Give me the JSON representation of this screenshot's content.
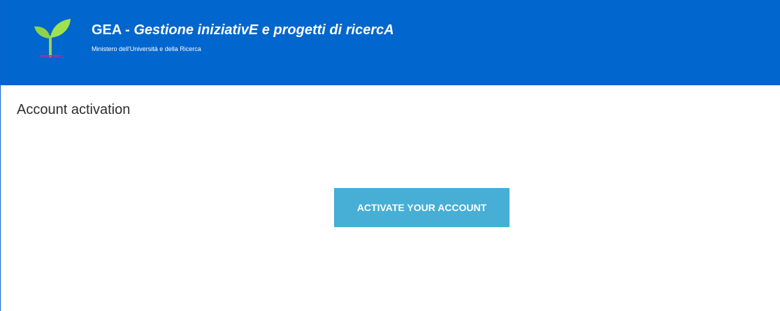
{
  "header": {
    "title_prefix": "GEA - ",
    "title_italic": "Gestione iniziativE e progetti di ricercA",
    "subtitle": "Ministero dell'Università e della Ricerca",
    "background_color": "#0166cd",
    "logo_icon": "sprout-icon"
  },
  "main": {
    "title": "Account activation",
    "activate_button_label": "ACTIVATE YOUR ACCOUNT",
    "button_color": "#47aed6"
  }
}
